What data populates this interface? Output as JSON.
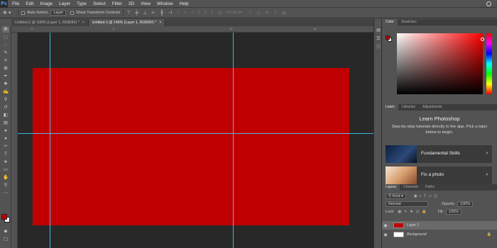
{
  "app": {
    "logo": "Ps"
  },
  "menu": [
    "File",
    "Edit",
    "Image",
    "Layer",
    "Type",
    "Select",
    "Filter",
    "3D",
    "View",
    "Window",
    "Help"
  ],
  "options": {
    "auto_select_label": "Auto-Select:",
    "auto_select_value": "Layer",
    "transform_label": "Show Transform Controls",
    "mode_3d": "3D Mode:"
  },
  "tabs": [
    {
      "label": "Untitled-2 @ 108% (Layer 1, RGB/8#) *",
      "active": false
    },
    {
      "label": "Untitled-3 @ 145% (Layer 1, RGB/8#) *",
      "active": true
    }
  ],
  "ruler": {
    "top_ticks": [
      "0",
      "5",
      "10",
      "15"
    ]
  },
  "color_panel": {
    "tabs": [
      "Color",
      "Swatches"
    ],
    "fg": "#c00000",
    "bg": "#ffffff"
  },
  "learn": {
    "tabs": [
      "Learn",
      "Libraries",
      "Adjustments"
    ],
    "title": "Learn Photoshop",
    "subtitle": "Step-by-step tutorials directly in the app. Pick a topic below to begin.",
    "cards": [
      {
        "label": "Fundamental Skills"
      },
      {
        "label": "Fix a photo"
      }
    ]
  },
  "layers": {
    "tabs": [
      "Layers",
      "Channels",
      "Paths"
    ],
    "kind_label": "Kind",
    "blend_mode": "Normal",
    "opacity_label": "Opacity:",
    "opacity_value": "100%",
    "lock_label": "Lock:",
    "fill_label": "Fill:",
    "fill_value": "100%",
    "items": [
      {
        "name": "Layer 1",
        "color": "#c00000",
        "selected": true
      },
      {
        "name": "Background",
        "color": "#ffffff",
        "selected": false
      }
    ]
  },
  "colors": {
    "canvas_fill": "#c00000",
    "guide": "#3fd2ff"
  }
}
